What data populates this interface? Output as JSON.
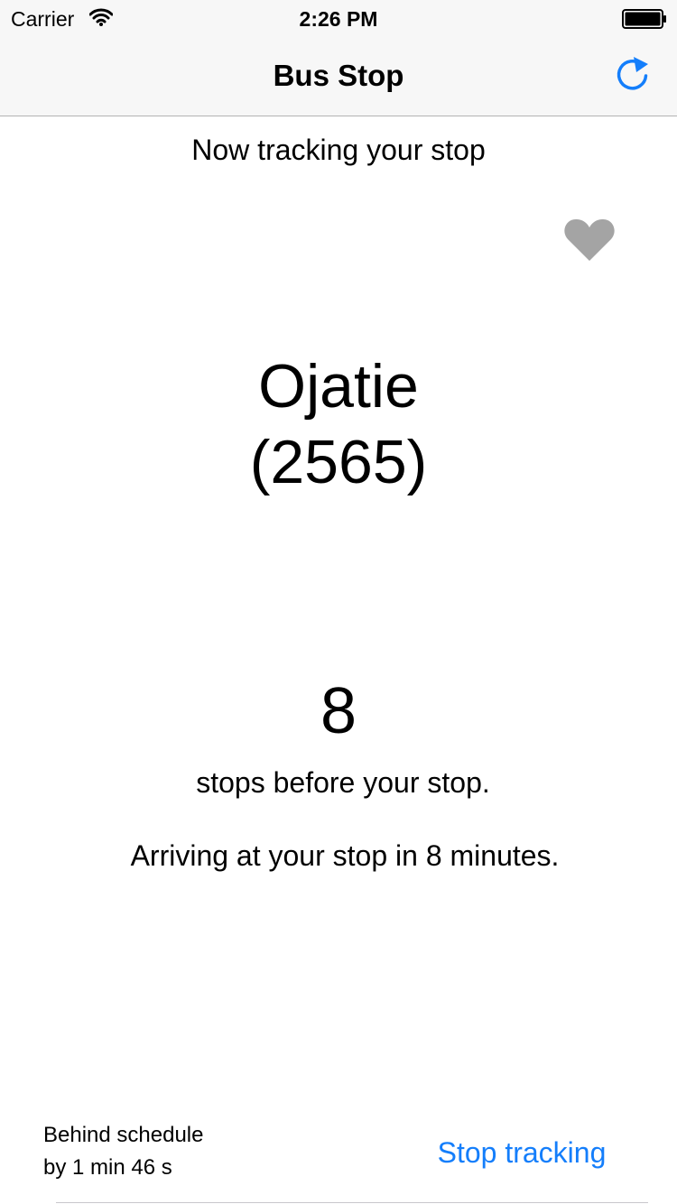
{
  "status_bar": {
    "carrier": "Carrier",
    "time": "2:26 PM",
    "wifi_icon": "wifi-icon",
    "battery_icon": "battery-full-icon"
  },
  "nav_bar": {
    "title": "Bus Stop",
    "refresh_icon": "refresh-icon"
  },
  "main": {
    "tracking_label": "Now tracking your stop",
    "favorite_icon": "heart-icon",
    "stop_name": "Ojatie",
    "stop_code": "(2565)",
    "stops_remaining": "8",
    "stops_caption": "stops before your stop.",
    "arrival_text": "Arriving at your stop in 8 minutes."
  },
  "footer": {
    "schedule_line1": "Behind schedule",
    "schedule_line2": "by 1 min 46 s",
    "stop_tracking_label": "Stop tracking"
  },
  "colors": {
    "accent": "#147efb",
    "heart": "#a4a4a4",
    "bar_background": "#f7f7f7"
  }
}
